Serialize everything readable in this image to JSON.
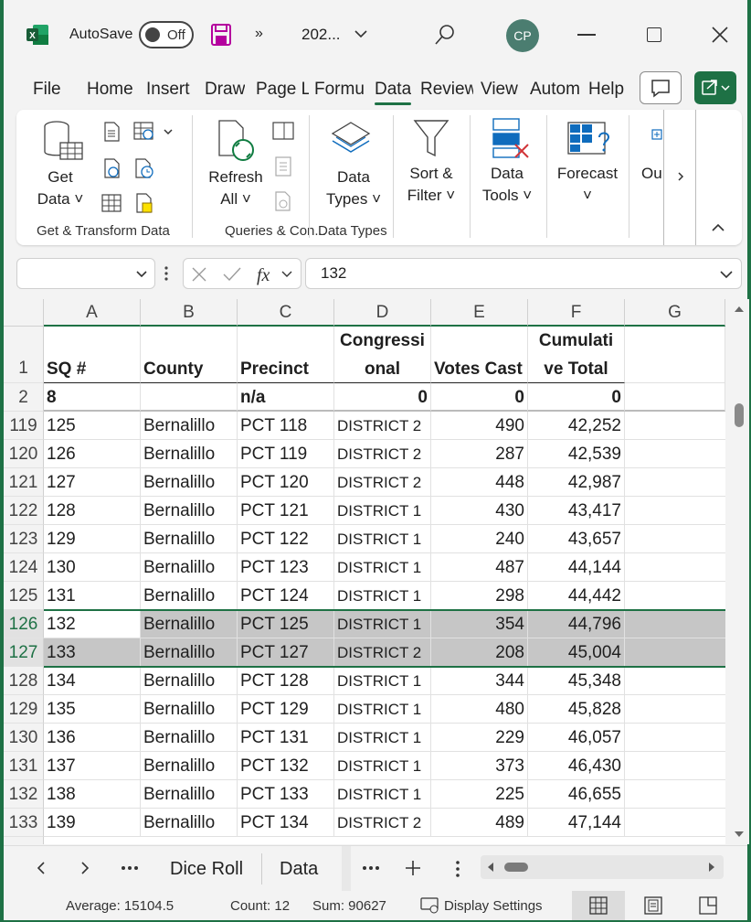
{
  "title_bar": {
    "autosave_label": "AutoSave",
    "autosave_state": "Off",
    "doc_name": "202...",
    "more": "»",
    "avatar_initials": "CP"
  },
  "menu_tabs": [
    "File",
    "Home",
    "Insert",
    "Draw",
    "Page L",
    "Formu",
    "Data",
    "Review",
    "View",
    "Autom",
    "Help"
  ],
  "active_tab": "Data",
  "ribbon": {
    "get_data": [
      "Get",
      "Data ˅"
    ],
    "refresh_all": [
      "Refresh",
      "All ˅"
    ],
    "data_types": [
      "Data",
      "Types ˅"
    ],
    "sort_filter": [
      "Sort &",
      "Filter ˅"
    ],
    "data_tools": [
      "Data",
      "Tools ˅"
    ],
    "forecast": [
      "Forecast",
      "˅"
    ],
    "outline": "Ou",
    "groups": {
      "get_transform": "Get & Transform Data",
      "queries": "Queries & Con...",
      "data_types": "Data Types"
    }
  },
  "formula_bar": {
    "name_box": "",
    "value": "132"
  },
  "columns": [
    "A",
    "B",
    "C",
    "D",
    "E",
    "F",
    "G"
  ],
  "header_row": {
    "row_num": "1",
    "cells": [
      "SQ #",
      "County",
      "Precinct",
      "Congressi\nonal",
      "Votes Cast",
      "Cumulati\nve Total",
      ""
    ]
  },
  "row2": {
    "row_num": "2",
    "cells": [
      "8",
      "",
      "n/a",
      "0",
      "0",
      "0",
      ""
    ]
  },
  "rows": [
    {
      "n": "119",
      "cells": [
        "125",
        "Bernalillo",
        "PCT 118",
        "DISTRICT 2",
        "490",
        "42,252"
      ]
    },
    {
      "n": "120",
      "cells": [
        "126",
        "Bernalillo",
        "PCT 119",
        "DISTRICT 2",
        "287",
        "42,539"
      ]
    },
    {
      "n": "121",
      "cells": [
        "127",
        "Bernalillo",
        "PCT 120",
        "DISTRICT 2",
        "448",
        "42,987"
      ]
    },
    {
      "n": "122",
      "cells": [
        "128",
        "Bernalillo",
        "PCT 121",
        "DISTRICT 1",
        "430",
        "43,417"
      ]
    },
    {
      "n": "123",
      "cells": [
        "129",
        "Bernalillo",
        "PCT 122",
        "DISTRICT 1",
        "240",
        "43,657"
      ]
    },
    {
      "n": "124",
      "cells": [
        "130",
        "Bernalillo",
        "PCT 123",
        "DISTRICT 1",
        "487",
        "44,144"
      ]
    },
    {
      "n": "125",
      "cells": [
        "131",
        "Bernalillo",
        "PCT 124",
        "DISTRICT 1",
        "298",
        "44,442"
      ]
    },
    {
      "n": "126",
      "cells": [
        "132",
        "Bernalillo",
        "PCT 125",
        "DISTRICT 1",
        "354",
        "44,796"
      ],
      "selected": true
    },
    {
      "n": "127",
      "cells": [
        "133",
        "Bernalillo",
        "PCT 127",
        "DISTRICT 2",
        "208",
        "45,004"
      ],
      "selected": true
    },
    {
      "n": "128",
      "cells": [
        "134",
        "Bernalillo",
        "PCT 128",
        "DISTRICT 1",
        "344",
        "45,348"
      ]
    },
    {
      "n": "129",
      "cells": [
        "135",
        "Bernalillo",
        "PCT 129",
        "DISTRICT 1",
        "480",
        "45,828"
      ]
    },
    {
      "n": "130",
      "cells": [
        "136",
        "Bernalillo",
        "PCT 131",
        "DISTRICT 1",
        "229",
        "46,057"
      ]
    },
    {
      "n": "131",
      "cells": [
        "137",
        "Bernalillo",
        "PCT 132",
        "DISTRICT 1",
        "373",
        "46,430"
      ]
    },
    {
      "n": "132",
      "cells": [
        "138",
        "Bernalillo",
        "PCT 133",
        "DISTRICT 1",
        "225",
        "46,655"
      ]
    },
    {
      "n": "133",
      "cells": [
        "139",
        "Bernalillo",
        "PCT 134",
        "DISTRICT 2",
        "489",
        "47,144"
      ]
    }
  ],
  "sheet_tabs": [
    "Dice Roll",
    "Data"
  ],
  "active_sheet": "Data",
  "status": {
    "average": "Average: 15104.5",
    "count": "Count: 12",
    "sum": "Sum: 90627",
    "display_settings": "Display Settings"
  }
}
